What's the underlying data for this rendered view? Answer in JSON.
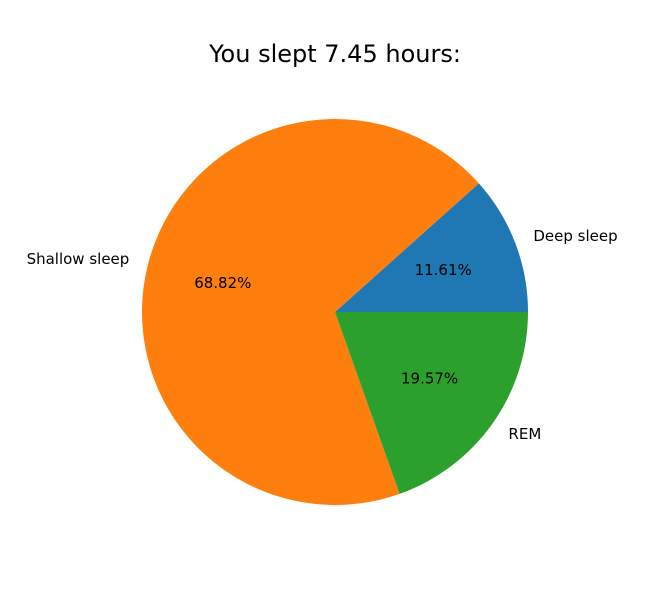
{
  "chart_data": {
    "type": "pie",
    "title": "You slept 7.45 hours:",
    "labels": [
      "Deep sleep",
      "Shallow sleep",
      "REM"
    ],
    "values": [
      11.61,
      68.82,
      19.57
    ],
    "percent_labels": [
      "11.61%",
      "68.82%",
      "19.57%"
    ],
    "colors": [
      "#1f77b4",
      "#ff7f0e",
      "#2ca02c"
    ],
    "start_angle_deg": 0,
    "direction": "counterclockwise"
  }
}
